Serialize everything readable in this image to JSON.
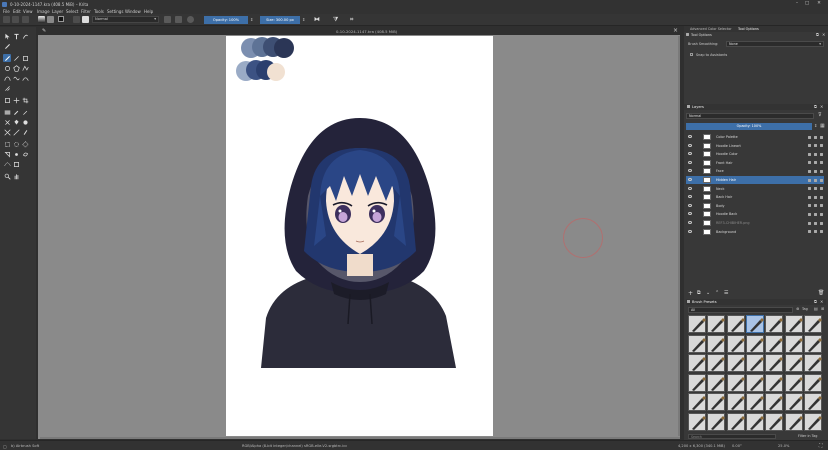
{
  "app": {
    "title": "0-10-2024-1147.kra (408.5 MiB) – Krita",
    "window_buttons": [
      "–",
      "□",
      "✕"
    ]
  },
  "menu": [
    "File",
    "Edit",
    "View",
    "Image",
    "Layer",
    "Select",
    "Filter",
    "Tools",
    "Settings",
    "Window",
    "Help"
  ],
  "toolbar": {
    "blend_mode": "Normal",
    "opacity_label": "Opacity: 100%",
    "size_label": "Size: 300.00 px",
    "fg_color": "#151515",
    "bg_color": "#f2f2f2"
  },
  "document": {
    "tab_title": "0-10-2024-1147.kra (408.5 MiB)"
  },
  "tool_options": {
    "tabs": [
      "Advanced Color Selector",
      "Tool Options"
    ],
    "header": "Tool Options",
    "brush_smoothing_label": "Brush Smoothing:",
    "brush_smoothing_value": "None",
    "snap_label": "Snap to Assistants"
  },
  "layers": {
    "title": "Layers",
    "blend_mode": "Normal",
    "opacity_label": "Opacity: 100%",
    "items": [
      {
        "name": "Color Palette",
        "selected": false
      },
      {
        "name": "Hoodie Lineart",
        "selected": false
      },
      {
        "name": "Hoodie Color",
        "selected": false
      },
      {
        "name": "Front Hair",
        "selected": false
      },
      {
        "name": "Face",
        "selected": false
      },
      {
        "name": "Hidden Hair",
        "selected": true
      },
      {
        "name": "Neck",
        "selected": false
      },
      {
        "name": "Back Hair",
        "selected": false
      },
      {
        "name": "Body",
        "selected": false
      },
      {
        "name": "Hoodie Back",
        "selected": false
      },
      {
        "name": "REF3-CHIBIHER.png",
        "selected": false,
        "dim": true
      },
      {
        "name": "Background",
        "selected": false
      }
    ]
  },
  "brush_presets": {
    "title": "Brush Presets",
    "filter_all": "All",
    "tag_label": "Tag",
    "search_placeholder": "Search",
    "filter_in_tag": "Filter in Tag"
  },
  "status": {
    "brush": "b) Airbrush Soft",
    "color_info": "RGB/Alpha (8-bit integer/channel)  sRGB-elle-V2-srgbtrc.icc",
    "dimensions": "4,200 x 6,300 (340.1 MiB)",
    "rotation": "0.00°",
    "zoom": "25.0%"
  },
  "palette_swatches": [
    "#7c8fb0",
    "#5e7396",
    "#3e4f73",
    "#2b3656",
    "#9aabc6",
    "#3c5283",
    "#2b3f6e",
    "#f1e1d2"
  ]
}
